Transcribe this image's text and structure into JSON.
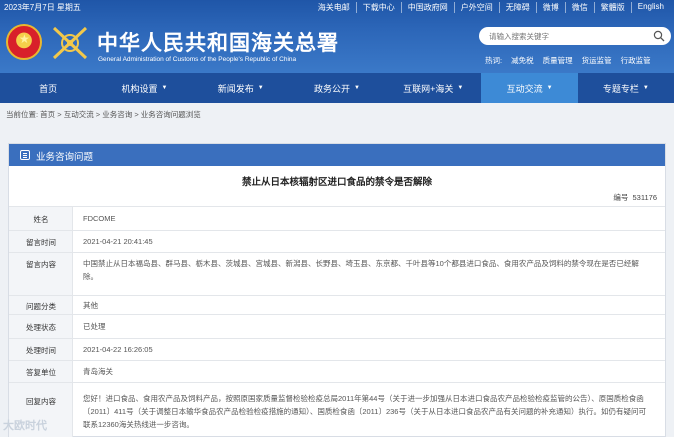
{
  "topbar": {
    "date": "2023年7月7日 星期五",
    "links": [
      "海关电邮",
      "下载中心",
      "中国政府网",
      "户外空间",
      "无障碍",
      "微博",
      "微信",
      "繁體版",
      "English"
    ]
  },
  "header": {
    "title_cn": "中华人民共和国海关总署",
    "title_en": "General Administration of Customs of the People's Republic of China",
    "search_placeholder": "请输入搜索关键字",
    "hot_label": "热词:",
    "hot_words": [
      "减免税",
      "质量管理",
      "货运监管",
      "行政监管"
    ]
  },
  "nav": {
    "items": [
      {
        "label": "首页",
        "caret": false
      },
      {
        "label": "机构设置",
        "caret": true
      },
      {
        "label": "新闻发布",
        "caret": true
      },
      {
        "label": "政务公开",
        "caret": true
      },
      {
        "label": "互联网+海关",
        "caret": true
      },
      {
        "label": "互动交流",
        "caret": true
      },
      {
        "label": "专题专栏",
        "caret": true
      }
    ],
    "active_index": 5
  },
  "breadcrumb": "当前位置: 首页 > 互动交流 > 业务咨询 > 业务咨询问题浏览",
  "panel": {
    "title": "业务咨询问题",
    "question_title": "禁止从日本核辐射区进口食品的禁令是否解除",
    "serial_label": "编号",
    "serial_value": "531176"
  },
  "rows": {
    "name": {
      "label": "姓名",
      "value": "FDCOME"
    },
    "time": {
      "label": "留言时间",
      "value": "2021-04-21 20:41:45"
    },
    "content": {
      "label": "留言内容",
      "value": "中国禁止从日本福岛县、群马县、栃木县、茨城县、宫城县、新潟县、长野县、埼玉县、东京都、千叶县等10个都县进口食品、食用农产品及饲料的禁令现在是否已经解除。"
    },
    "category": {
      "label": "问题分类",
      "value": "其他"
    },
    "status": {
      "label": "处理状态",
      "value": "已处理"
    },
    "handle_time": {
      "label": "处理时间",
      "value": "2021-04-22 16:26:05"
    },
    "unit": {
      "label": "答复单位",
      "value": "青岛海关"
    },
    "reply": {
      "label": "回复内容",
      "value": "您好！进口食品、食用农产品及饲料产品，按照原国家质量监督检验检疫总局2011年第44号（关于进一步加强从日本进口食品农产品检验检疫监管的公告）、原国质检食函〔2011〕411号（关于调整日本输华食品农产品检验检疫措施的通知）、国质检食函〔2011〕236号（关于从日本进口食品农产品有关问题的补充通知）执行。如仍有疑问可联系12360海关热线进一步咨询。"
    }
  },
  "watermark": "大欧时代",
  "colors": {
    "header_blue": "#2c66b8",
    "nav_blue": "#1e4f9c",
    "nav_active": "#3d8ad6",
    "panel_head": "#3a6fbe"
  }
}
